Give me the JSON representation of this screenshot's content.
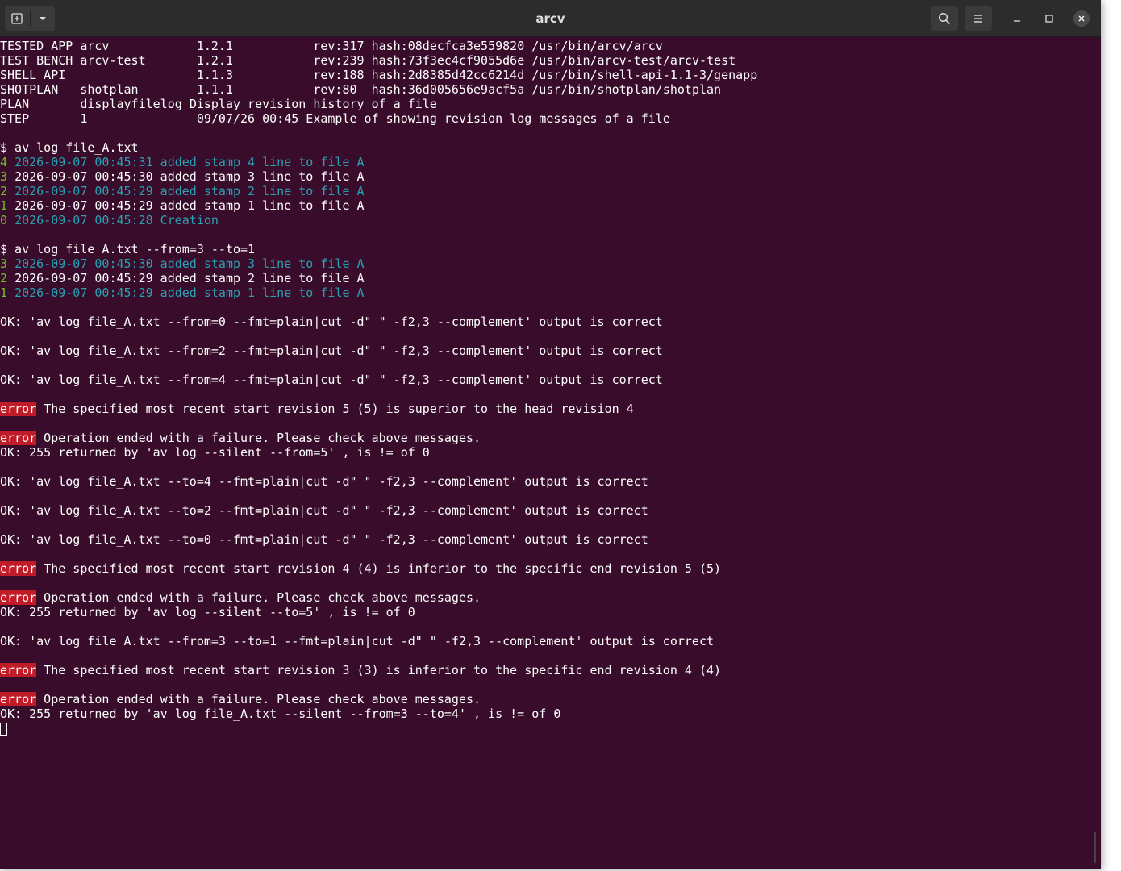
{
  "window": {
    "title": "arcv"
  },
  "icons": {
    "new_tab": "new-tab-icon",
    "dropdown": "chevron-down-icon",
    "search": "search-icon",
    "menu": "hamburger-menu-icon",
    "minimize": "minimize-icon",
    "maximize": "maximize-icon",
    "close": "close-icon"
  },
  "colors": {
    "background": "#380c2a",
    "green": "#6ebf26",
    "cyan": "#2aa1b3",
    "error_bg": "#c01c28",
    "titlebar": "#2c2c2c"
  },
  "header_rows": [
    {
      "label": "TESTED APP ",
      "name": "arcv           ",
      "version": "1.2.1          ",
      "rev": "rev:317",
      "hash": "hash:08decfca3e559820",
      "path": "/usr/bin/arcv/arcv"
    },
    {
      "label": "TEST BENCH ",
      "name": "arcv-test      ",
      "version": "1.2.1          ",
      "rev": "rev:239",
      "hash": "hash:73f3ec4cf9055d6e",
      "path": "/usr/bin/arcv-test/arcv-test"
    },
    {
      "label": "SHELL API  ",
      "name": "               ",
      "version": "1.1.3          ",
      "rev": "rev:188",
      "hash": "hash:2d8385d42cc6214d",
      "path": "/usr/bin/shell-api-1.1-3/genapp"
    },
    {
      "label": "SHOTPLAN   ",
      "name": "shotplan       ",
      "version": "1.1.1          ",
      "rev": "rev:80 ",
      "hash": "hash:36d005656e9acf5a",
      "path": "/usr/bin/shotplan/shotplan"
    }
  ],
  "plan": {
    "label": "PLAN       ",
    "name": "displayfilelog",
    "text": "Display revision history of a file"
  },
  "step": {
    "label": "STEP       ",
    "num": "1              ",
    "text": "09/07/26 00:45 Example of showing revision log messages of a file"
  },
  "cmd1": "$ av log file_A.txt",
  "log1": [
    {
      "rev": "4",
      "text": "2026-09-07 00:45:31 added stamp 4 line to file A"
    },
    {
      "rev": "3",
      "text": "2026-09-07 00:45:30 added stamp 3 line to file A"
    },
    {
      "rev": "2",
      "text": "2026-09-07 00:45:29 added stamp 2 line to file A"
    },
    {
      "rev": "1",
      "text": "2026-09-07 00:45:29 added stamp 1 line to file A"
    },
    {
      "rev": "0",
      "text": "2026-09-07 00:45:28 Creation"
    }
  ],
  "cmd2": "$ av log file_A.txt --from=3 --to=1",
  "log2": [
    {
      "rev": "3",
      "text": "2026-09-07 00:45:30 added stamp 3 line to file A"
    },
    {
      "rev": "2",
      "text": "2026-09-07 00:45:29 added stamp 2 line to file A"
    },
    {
      "rev": "1",
      "text": "2026-09-07 00:45:29 added stamp 1 line to file A"
    }
  ],
  "ok_from0": "OK: 'av log file_A.txt --from=0 --fmt=plain|cut -d\" \" -f2,3 --complement' output is correct",
  "ok_from2": "OK: 'av log file_A.txt --from=2 --fmt=plain|cut -d\" \" -f2,3 --complement' output is correct",
  "ok_from4": "OK: 'av log file_A.txt --from=4 --fmt=plain|cut -d\" \" -f2,3 --complement' output is correct",
  "error_label": "error",
  "err1": " The specified most recent start revision 5 (5) is superior to the head revision 4",
  "err_fail": " Operation ended with a failure. Please check above messages.",
  "ok_ret1": "OK: 255 returned by 'av log --silent --from=5' , is != of 0",
  "ok_to4": "OK: 'av log file_A.txt --to=4 --fmt=plain|cut -d\" \" -f2,3 --complement' output is correct",
  "ok_to2": "OK: 'av log file_A.txt --to=2 --fmt=plain|cut -d\" \" -f2,3 --complement' output is correct",
  "ok_to0": "OK: 'av log file_A.txt --to=0 --fmt=plain|cut -d\" \" -f2,3 --complement' output is correct",
  "err2": " The specified most recent start revision 4 (4) is inferior to the specific end revision 5 (5)",
  "ok_ret2": "OK: 255 returned by 'av log --silent --to=5' , is != of 0",
  "ok_from3to1": "OK: 'av log file_A.txt --from=3 --to=1 --fmt=plain|cut -d\" \" -f2,3 --complement' output is correct",
  "err3": " The specified most recent start revision 3 (3) is inferior to the specific end revision 4 (4)",
  "ok_ret3": "OK: 255 returned by 'av log file_A.txt --silent --from=3 --to=4' , is != of 0"
}
